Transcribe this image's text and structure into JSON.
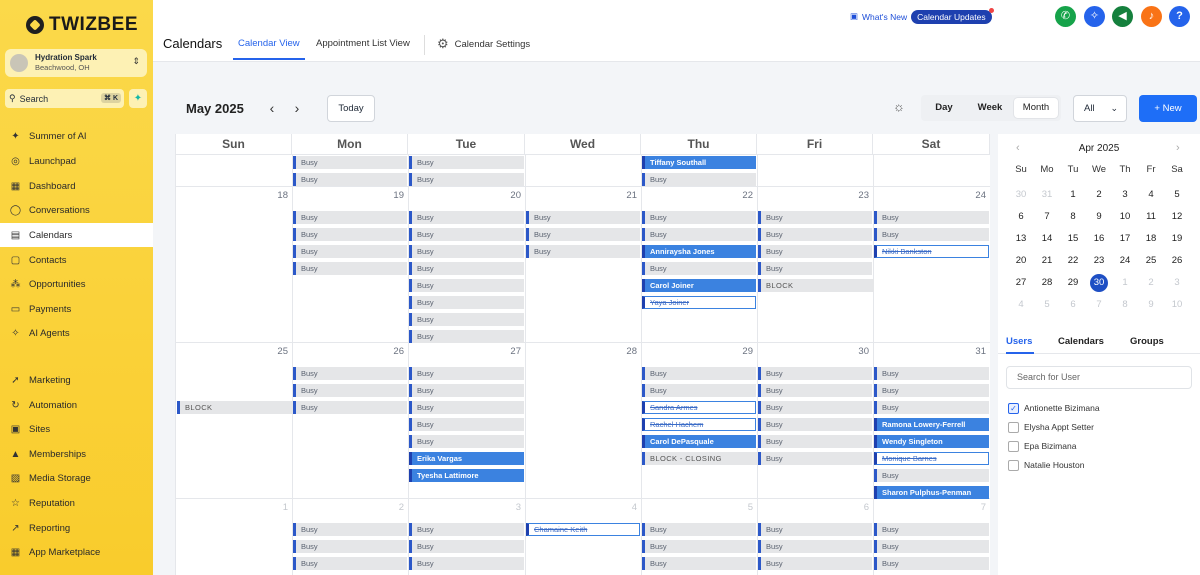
{
  "brand": {
    "name": "TWIZBEE"
  },
  "account": {
    "name": "Hydration Spark",
    "location": "Beachwood, OH"
  },
  "search": {
    "placeholder": "Search",
    "shortcut": "⌘ K"
  },
  "sidebar": {
    "items": [
      {
        "label": "Summer of AI",
        "icon": "sparkle-icon"
      },
      {
        "label": "Launchpad",
        "icon": "rocket-icon"
      },
      {
        "label": "Dashboard",
        "icon": "grid-icon"
      },
      {
        "label": "Conversations",
        "icon": "chat-icon"
      },
      {
        "label": "Calendars",
        "icon": "calendar-icon",
        "active": true
      },
      {
        "label": "Contacts",
        "icon": "contacts-icon"
      },
      {
        "label": "Opportunities",
        "icon": "opportunities-icon"
      },
      {
        "label": "Payments",
        "icon": "payments-icon"
      },
      {
        "label": "AI Agents",
        "icon": "ai-agents-icon"
      },
      {
        "label": "Marketing",
        "icon": "marketing-icon"
      },
      {
        "label": "Automation",
        "icon": "automation-icon"
      },
      {
        "label": "Sites",
        "icon": "sites-icon"
      },
      {
        "label": "Memberships",
        "icon": "memberships-icon"
      },
      {
        "label": "Media Storage",
        "icon": "media-icon"
      },
      {
        "label": "Reputation",
        "icon": "star-icon"
      },
      {
        "label": "Reporting",
        "icon": "chart-icon"
      },
      {
        "label": "App Marketplace",
        "icon": "marketplace-icon"
      }
    ]
  },
  "header": {
    "title": "Calendars",
    "tabs": [
      "Calendar View",
      "Appointment List View"
    ],
    "settings": "Calendar Settings",
    "whats_new": "What's New",
    "updates": "Calendar Updates",
    "help": "?"
  },
  "toolbar": {
    "month": "May 2025",
    "today": "Today",
    "views": [
      "Day",
      "Week",
      "Month"
    ],
    "active_view": "Month",
    "filter": "All",
    "new": "+ New"
  },
  "calendar": {
    "weekdays": [
      "Sun",
      "Mon",
      "Tue",
      "Wed",
      "Thu",
      "Fri",
      "Sat"
    ],
    "weeks": [
      {
        "days": [
          "",
          "",
          "",
          "",
          "",
          "",
          ""
        ],
        "events": [
          [],
          [
            {
              "t": "busy",
              "l": "Busy"
            },
            {
              "t": "busy",
              "l": "Busy"
            }
          ],
          [
            {
              "t": "busy",
              "l": "Busy"
            },
            {
              "t": "busy",
              "l": "Busy"
            }
          ],
          [],
          [
            {
              "t": "blue",
              "l": "Tiffany Southall"
            },
            {
              "t": "busy",
              "l": "Busy"
            }
          ],
          [],
          []
        ]
      },
      {
        "days": [
          "18",
          "19",
          "20",
          "21",
          "22",
          "23",
          "24"
        ],
        "events": [
          [],
          [
            {
              "t": "busy",
              "l": "Busy"
            },
            {
              "t": "busy",
              "l": "Busy"
            },
            {
              "t": "busy",
              "l": "Busy"
            },
            {
              "t": "busy",
              "l": "Busy"
            }
          ],
          [
            {
              "t": "busy",
              "l": "Busy"
            },
            {
              "t": "busy",
              "l": "Busy"
            },
            {
              "t": "busy",
              "l": "Busy"
            },
            {
              "t": "busy",
              "l": "Busy"
            },
            {
              "t": "busy",
              "l": "Busy"
            },
            {
              "t": "busy",
              "l": "Busy"
            },
            {
              "t": "busy",
              "l": "Busy"
            },
            {
              "t": "busy",
              "l": "Busy"
            }
          ],
          [
            {
              "t": "busy",
              "l": "Busy"
            },
            {
              "t": "busy",
              "l": "Busy"
            },
            {
              "t": "busy",
              "l": "Busy"
            }
          ],
          [
            {
              "t": "busy",
              "l": "Busy"
            },
            {
              "t": "busy",
              "l": "Busy"
            },
            {
              "t": "blue",
              "l": "Anniraysha Jones"
            },
            {
              "t": "busy",
              "l": "Busy"
            },
            {
              "t": "blue",
              "l": "Carol Joiner"
            },
            {
              "t": "out",
              "l": "Yaya Joiner"
            }
          ],
          [
            {
              "t": "busy",
              "l": "Busy"
            },
            {
              "t": "busy",
              "l": "Busy"
            },
            {
              "t": "busy",
              "l": "Busy"
            },
            {
              "t": "busy",
              "l": "Busy"
            },
            {
              "t": "block",
              "l": "BLOCK"
            }
          ],
          [
            {
              "t": "busy",
              "l": "Busy"
            },
            {
              "t": "busy",
              "l": "Busy"
            },
            {
              "t": "out",
              "l": "Nikki Bankston"
            }
          ]
        ]
      },
      {
        "days": [
          "25",
          "26",
          "27",
          "28",
          "29",
          "30",
          "31"
        ],
        "events": [
          [
            {
              "t": "gap"
            },
            {
              "t": "gap"
            },
            {
              "t": "block",
              "l": "BLOCK"
            }
          ],
          [
            {
              "t": "busy",
              "l": "Busy"
            },
            {
              "t": "busy",
              "l": "Busy"
            },
            {
              "t": "busy",
              "l": "Busy"
            }
          ],
          [
            {
              "t": "busy",
              "l": "Busy"
            },
            {
              "t": "busy",
              "l": "Busy"
            },
            {
              "t": "busy",
              "l": "Busy"
            },
            {
              "t": "busy",
              "l": "Busy"
            },
            {
              "t": "busy",
              "l": "Busy"
            },
            {
              "t": "blue",
              "l": "Erika Vargas"
            },
            {
              "t": "blue",
              "l": "Tyesha Lattimore"
            }
          ],
          [],
          [
            {
              "t": "busy",
              "l": "Busy"
            },
            {
              "t": "busy",
              "l": "Busy"
            },
            {
              "t": "out",
              "l": "Sandra Armes"
            },
            {
              "t": "out",
              "l": "Rachel Hachem"
            },
            {
              "t": "blue",
              "l": "Carol DePasquale"
            },
            {
              "t": "block",
              "l": "BLOCK - CLOSING"
            }
          ],
          [
            {
              "t": "busy",
              "l": "Busy"
            },
            {
              "t": "busy",
              "l": "Busy"
            },
            {
              "t": "busy",
              "l": "Busy"
            },
            {
              "t": "busy",
              "l": "Busy"
            },
            {
              "t": "busy",
              "l": "Busy"
            },
            {
              "t": "busy",
              "l": "Busy"
            }
          ],
          [
            {
              "t": "busy",
              "l": "Busy"
            },
            {
              "t": "busy",
              "l": "Busy"
            },
            {
              "t": "busy",
              "l": "Busy"
            },
            {
              "t": "blue",
              "l": "Ramona Lowery-Ferrell"
            },
            {
              "t": "blue",
              "l": "Wendy Singleton"
            },
            {
              "t": "out",
              "l": "Monique Barnes"
            },
            {
              "t": "busy",
              "l": "Busy"
            },
            {
              "t": "blue",
              "l": "Sharon Pulphus-Penman"
            }
          ]
        ]
      },
      {
        "days": [
          "1",
          "2",
          "3",
          "4",
          "5",
          "6",
          "7"
        ],
        "muted": true,
        "events": [
          [],
          [
            {
              "t": "busy",
              "l": "Busy"
            },
            {
              "t": "busy",
              "l": "Busy"
            },
            {
              "t": "busy",
              "l": "Busy"
            }
          ],
          [
            {
              "t": "busy",
              "l": "Busy"
            },
            {
              "t": "busy",
              "l": "Busy"
            },
            {
              "t": "busy",
              "l": "Busy"
            }
          ],
          [
            {
              "t": "out",
              "l": "Chamaine Keith"
            }
          ],
          [
            {
              "t": "busy",
              "l": "Busy"
            },
            {
              "t": "busy",
              "l": "Busy"
            },
            {
              "t": "busy",
              "l": "Busy"
            }
          ],
          [
            {
              "t": "busy",
              "l": "Busy"
            },
            {
              "t": "busy",
              "l": "Busy"
            },
            {
              "t": "busy",
              "l": "Busy"
            }
          ],
          [
            {
              "t": "busy",
              "l": "Busy"
            },
            {
              "t": "busy",
              "l": "Busy"
            },
            {
              "t": "busy",
              "l": "Busy"
            }
          ]
        ]
      }
    ]
  },
  "mini": {
    "title": "Apr 2025",
    "weekdays": [
      "Su",
      "Mo",
      "Tu",
      "We",
      "Th",
      "Fr",
      "Sa"
    ],
    "weeks": [
      [
        "30",
        "31",
        "1",
        "2",
        "3",
        "4",
        "5"
      ],
      [
        "6",
        "7",
        "8",
        "9",
        "10",
        "11",
        "12"
      ],
      [
        "13",
        "14",
        "15",
        "16",
        "17",
        "18",
        "19"
      ],
      [
        "20",
        "21",
        "22",
        "23",
        "24",
        "25",
        "26"
      ],
      [
        "27",
        "28",
        "29",
        "30",
        "1",
        "2",
        "3"
      ],
      [
        "4",
        "5",
        "6",
        "7",
        "8",
        "9",
        "10"
      ]
    ],
    "selected": "30"
  },
  "panel": {
    "tabs": [
      "Users",
      "Calendars",
      "Groups"
    ],
    "search_placeholder": "Search for User",
    "users": [
      {
        "name": "Antionette Bizimana",
        "checked": true
      },
      {
        "name": "Elysha Appt Setter",
        "checked": false
      },
      {
        "name": "Epa Bizimana",
        "checked": false
      },
      {
        "name": "Natalie Houston",
        "checked": false
      }
    ]
  },
  "colors": {
    "accent": "#2563eb",
    "sidebar": "#fbd94a",
    "event_blue": "#3b82e0",
    "busy": "#e5e6e8"
  }
}
